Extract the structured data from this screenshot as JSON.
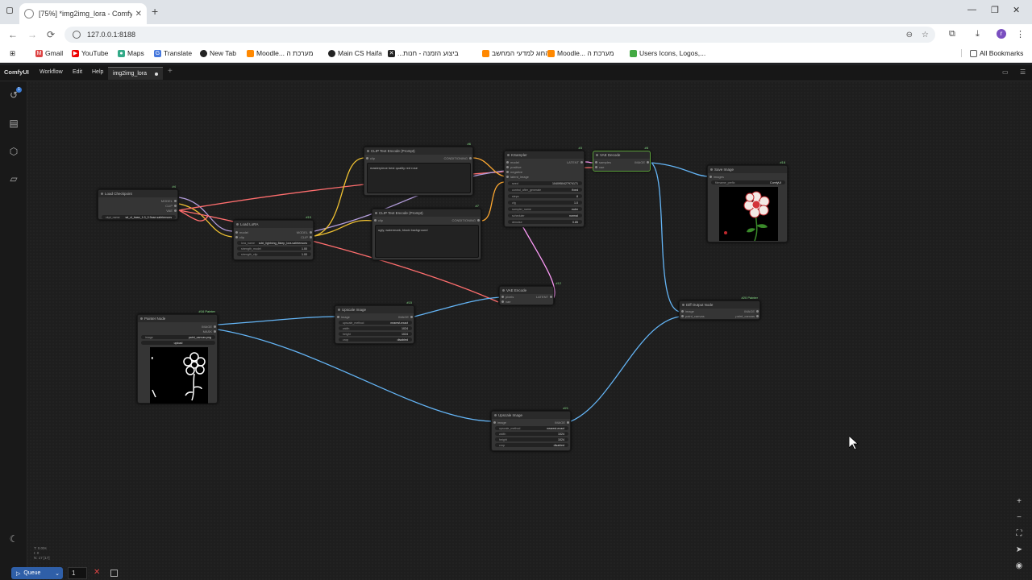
{
  "browser": {
    "tab_title": "[75%] *img2img_lora - ComfyUI",
    "url": "127.0.0.1:8188",
    "bookmarks": [
      "Gmail",
      "YouTube",
      "Maps",
      "Translate",
      "New Tab",
      "Moodle... מערכת ה",
      "Main CS Haifa",
      "...ביצוע הזמנה - חנות",
      "החוג למדעי המחשב",
      "Moodle... מערכת ה",
      "Users Icons, Logos,..."
    ],
    "all_bookmarks": "All Bookmarks",
    "avatar": "r"
  },
  "app": {
    "brand": "ComfyUI",
    "menu": [
      "Workflow",
      "Edit",
      "Help"
    ],
    "workflow_tab": "img2img_lora",
    "queue_label": "Queue",
    "queue_count": "1",
    "stats": [
      "T: 0.00s",
      "I: 0",
      "N: 17 [17]"
    ],
    "history_badge": "1"
  },
  "nodes": {
    "load_checkpoint": {
      "title": "Load Checkpoint",
      "id": "#4",
      "outputs": [
        "MODEL",
        "CLIP",
        "VAE"
      ],
      "widget_label": "ckpt_name",
      "widget_value": "sd_xl_base_1.0_0.9vae.safetensors"
    },
    "load_lora": {
      "title": "Load LoRA",
      "id": "#10",
      "inputs": [
        "model",
        "clip"
      ],
      "outputs": [
        "MODEL",
        "CLIP"
      ],
      "widgets": [
        {
          "label": "lora_name",
          "value": "sdxl_lightning_8step_lora.safetensors"
        },
        {
          "label": "strength_model",
          "value": "1.00"
        },
        {
          "label": "strength_clip",
          "value": "1.00"
        }
      ]
    },
    "clip_pos": {
      "title": "CLIP Text Encode (Prompt)",
      "id": "#6",
      "input": "clip",
      "output": "CONDITIONING",
      "text": "masterpiece best quality red rose"
    },
    "clip_neg": {
      "title": "CLIP Text Encode (Prompt)",
      "id": "#7",
      "input": "clip",
      "output": "CONDITIONING",
      "text": "ugly, watermark, black background"
    },
    "ksampler": {
      "title": "KSampler",
      "id": "#3",
      "inputs": [
        "model",
        "positive",
        "negative",
        "latent_image"
      ],
      "output": "LATENT",
      "widgets": [
        {
          "label": "seed",
          "value": "1040950427974171"
        },
        {
          "label": "control_after_generate",
          "value": "fixed"
        },
        {
          "label": "steps",
          "value": "8"
        },
        {
          "label": "cfg",
          "value": "1.0"
        },
        {
          "label": "sampler_name",
          "value": "euler"
        },
        {
          "label": "scheduler",
          "value": "normal"
        },
        {
          "label": "denoise",
          "value": "0.85"
        }
      ]
    },
    "vae_decode": {
      "title": "VAE Decode",
      "id": "#8",
      "inputs": [
        "samples",
        "vae"
      ],
      "output": "IMAGE"
    },
    "save_image": {
      "title": "Save Image",
      "id": "#18",
      "input": "images",
      "widget_label": "filename_prefix",
      "widget_value": "ComfyUI"
    },
    "load_image": {
      "title": "Painter Node",
      "id": "#16 Painter",
      "outputs": [
        "IMAGE",
        "MASK"
      ],
      "widget_label": "image",
      "widget_value": "paint_canvas.png",
      "upload_label": "upload"
    },
    "upscale_1": {
      "title": "Upscale Image",
      "id": "#15",
      "input": "image",
      "output": "IMAGE",
      "widgets": [
        {
          "label": "upscale_method",
          "value": "nearest-exact"
        },
        {
          "label": "width",
          "value": "1024"
        },
        {
          "label": "height",
          "value": "1024"
        },
        {
          "label": "crop",
          "value": "disabled"
        }
      ]
    },
    "vae_encode": {
      "title": "VAE Encode",
      "id": "#12",
      "inputs": [
        "pixels",
        "vae"
      ],
      "output": "LATENT"
    },
    "upscale_2": {
      "title": "Upscale Image",
      "id": "#21",
      "input": "image",
      "output": "IMAGE",
      "widgets": [
        {
          "label": "upscale_method",
          "value": "nearest-exact"
        },
        {
          "label": "width",
          "value": "1024"
        },
        {
          "label": "height",
          "value": "1024"
        },
        {
          "label": "crop",
          "value": "disabled"
        }
      ]
    },
    "diff_output": {
      "title": "Diff Output Node",
      "id": "#20 Painter",
      "inputs": [
        "image",
        "paint_canvas"
      ],
      "outputs": [
        "IMAGE",
        "paint_canvas"
      ]
    }
  },
  "colors": {
    "clip_wire": "#f1c232",
    "model_wire": "#b39ddb",
    "vae_wire": "#ff6e6e",
    "image_wire": "#64b5f6",
    "latent_wire": "#ff9cf9",
    "cond_wire": "#ffa931",
    "queue_button": "#2f5fa8"
  },
  "icons": [
    "history-icon",
    "queue-list-icon",
    "cube-icon",
    "folder-icon",
    "moon-icon",
    "zoom-in-icon",
    "zoom-out-icon",
    "fit-view-icon",
    "pointer-icon",
    "eye-icon"
  ]
}
